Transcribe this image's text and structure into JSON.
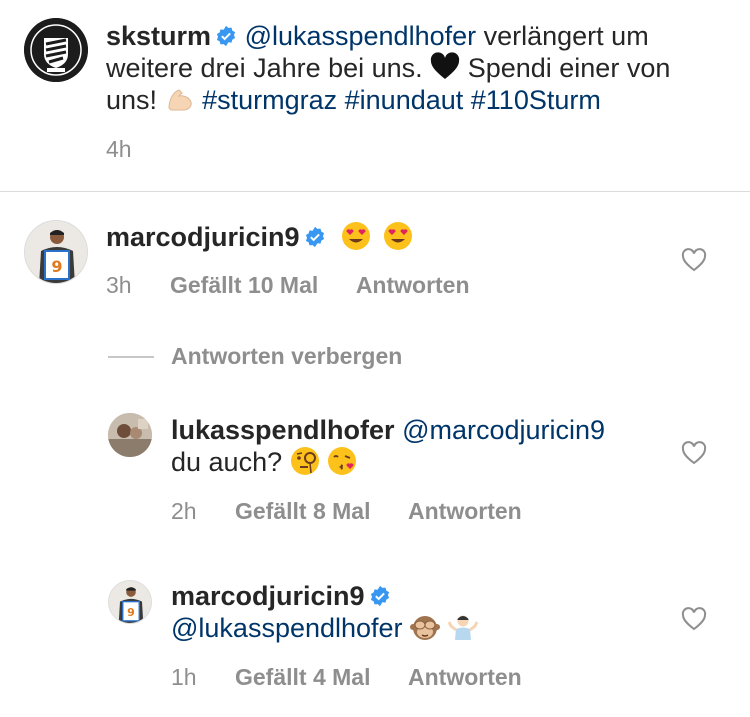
{
  "post": {
    "username": "sksturm",
    "mention": "@lukasspendlhofer",
    "text_part1": " verlängert um",
    "text_line2": "weitere drei Jahre bei uns.",
    "text_line2b": "Spendi einer von",
    "text_line3": "uns!",
    "hashtag1": "#sturmgraz",
    "hashtag2": "#inundaut",
    "hashtag3": "#110Sturm",
    "time": "4h"
  },
  "comments": [
    {
      "username": "marcodjuricin9",
      "verified": true,
      "time": "3h",
      "likes": "Gefällt 10 Mal",
      "reply": "Antworten"
    }
  ],
  "replies_toggle": "Antworten verbergen",
  "replies": [
    {
      "username": "lukasspendlhofer",
      "mention": "@marcodjuricin9",
      "text": "du auch?",
      "time": "2h",
      "likes": "Gefällt 8 Mal",
      "reply": "Antworten"
    },
    {
      "username": "marcodjuricin9",
      "verified": true,
      "mention": "@lukasspendlhofer",
      "time": "1h",
      "likes": "Gefällt 4 Mal",
      "reply": "Antworten"
    }
  ],
  "colors": {
    "text": "#262626",
    "link": "#003569",
    "secondary": "#8e8e8e",
    "verified": "#3897f0",
    "divider": "#dbdbdb"
  }
}
